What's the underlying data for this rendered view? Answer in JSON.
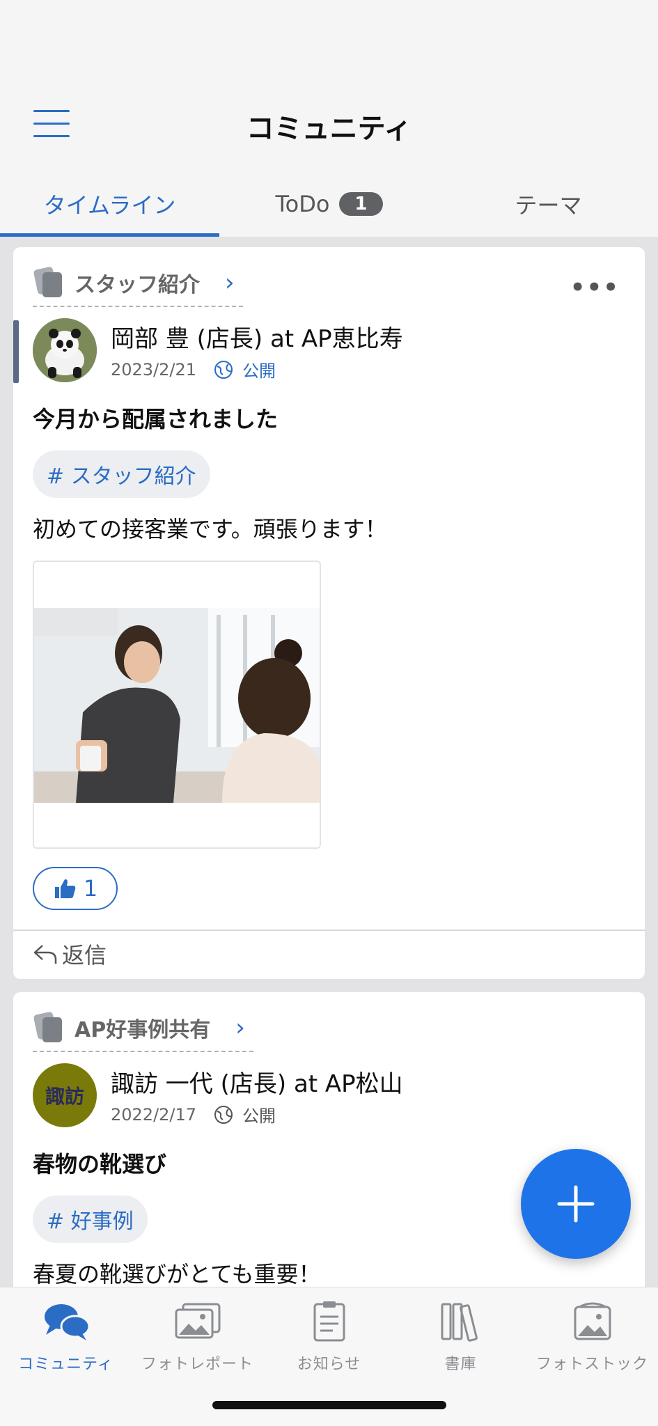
{
  "header": {
    "title": "コミュニティ"
  },
  "tabs": [
    {
      "label": "タイムライン",
      "active": true
    },
    {
      "label": "ToDo",
      "badge": "1"
    },
    {
      "label": "テーマ"
    }
  ],
  "posts": [
    {
      "category": "スタッフ紹介",
      "author": "岡部 豊 (店長) at AP恵比寿",
      "date": "2023/2/21",
      "visibility": "公開",
      "title": "今月から配属されました",
      "tag": "# スタッフ紹介",
      "body": "初めての接客業です。頑張ります！",
      "likes": "1",
      "reply": "返信"
    },
    {
      "category": "AP好事例共有",
      "author": "諏訪 一代 (店長) at AP松山",
      "avatar_text": "諏訪",
      "date": "2022/2/17",
      "visibility": "公開",
      "title": "春物の靴選び",
      "tag": "# 好事例",
      "body": "春夏の靴選びがとても重要！"
    }
  ],
  "nav": [
    {
      "label": "コミュニティ",
      "icon": "chat-bubbles-icon",
      "active": true
    },
    {
      "label": "フォトレポート",
      "icon": "photo-report-icon"
    },
    {
      "label": "お知らせ",
      "icon": "clipboard-icon"
    },
    {
      "label": "書庫",
      "icon": "books-icon"
    },
    {
      "label": "フォトストック",
      "icon": "photo-stock-icon"
    }
  ],
  "colors": {
    "accent": "#2b6cc4",
    "fab": "#1e73e8",
    "badge": "#5f6164"
  }
}
